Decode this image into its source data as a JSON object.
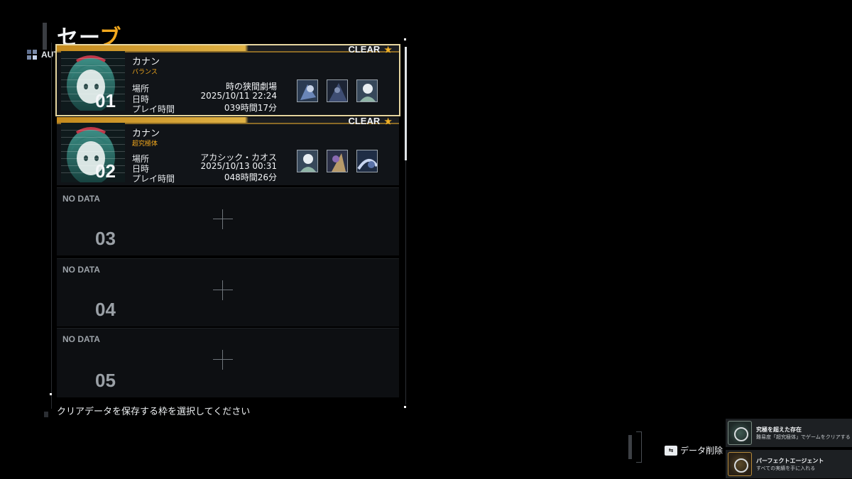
{
  "screen": {
    "title_main": "セー",
    "title_accent": "ブ",
    "auto_saving": "AUTO SAVING",
    "help_text": "クリアデータを保存する枠を選択してください"
  },
  "labels": {
    "location": "場所",
    "datetime": "日時",
    "playtime": "プレイ時間",
    "clear": "CLEAR",
    "star": "★",
    "no_data": "NO DATA"
  },
  "slots": [
    {
      "number": "01",
      "name": "カナン",
      "difficulty": "バランス",
      "location": "時の狭間劇場",
      "datetime": "2025/10/11 22:24",
      "playtime": "039時間17分",
      "clear": true,
      "party": [
        "party-member-1",
        "party-member-2",
        "party-member-3"
      ]
    },
    {
      "number": "02",
      "name": "カナン",
      "difficulty": "超究極体",
      "location": "アカシック・カオス",
      "datetime": "2025/10/13 00:31",
      "playtime": "048時間26分",
      "clear": true,
      "party": [
        "party-member-1",
        "party-member-2",
        "party-member-3"
      ]
    },
    {
      "number": "03",
      "empty": true
    },
    {
      "number": "04",
      "empty": true
    },
    {
      "number": "05",
      "empty": true
    }
  ],
  "actions": {
    "delete_label": "データ削除",
    "delete_key": "⇆"
  },
  "trophies": [
    {
      "title": "究極を超えた存在",
      "desc": "難易度「超究極体」でゲームをクリアする",
      "icon": "trophy-badge-icon"
    },
    {
      "title": "パーフェクトエージェント",
      "desc": "すべての実績を手に入れる",
      "icon": "trophy-agent-icon"
    }
  ],
  "colors": {
    "accent": "#f2a81d",
    "selected_outline": "#e6d6a0",
    "slot_bg": "#111418",
    "empty_bg": "#0d0f12"
  }
}
